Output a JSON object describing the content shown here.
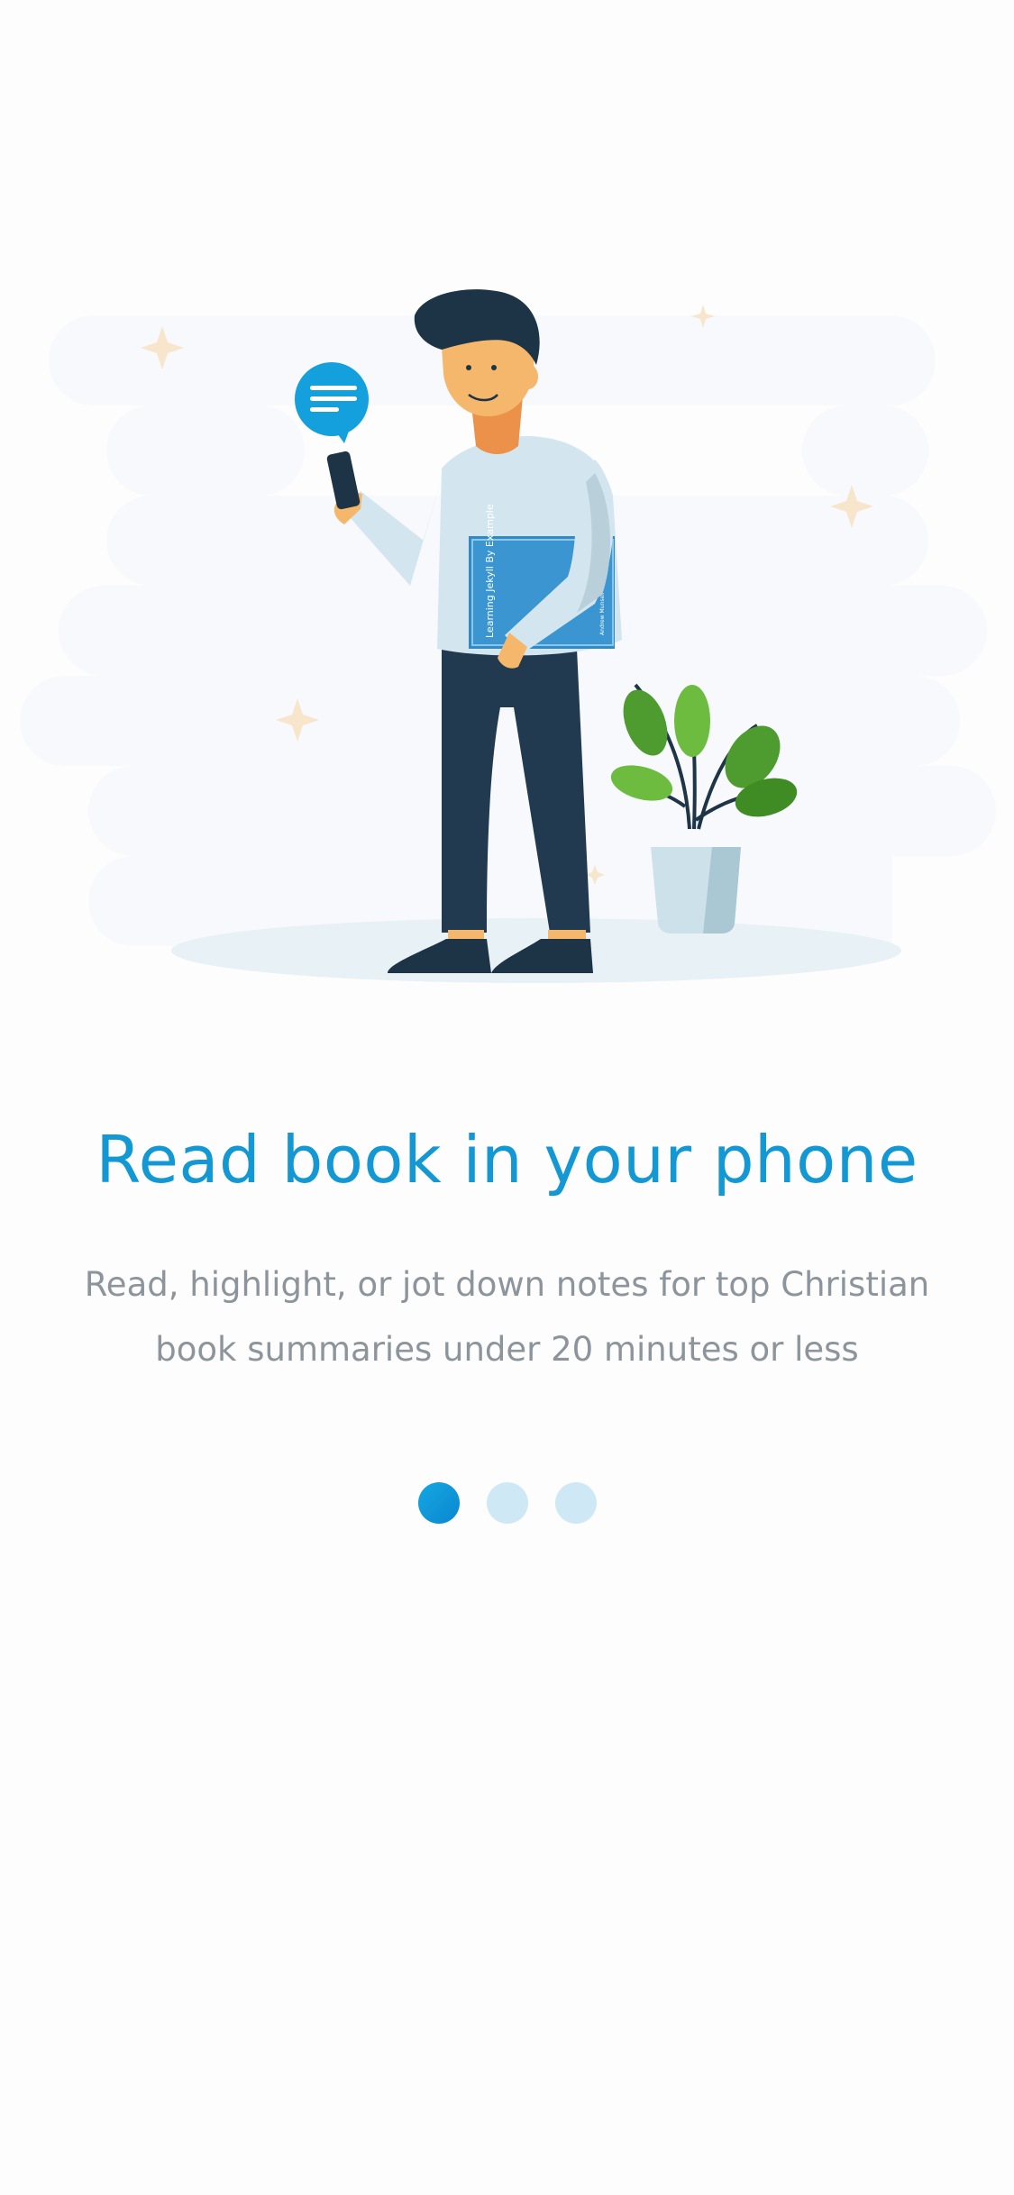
{
  "onboarding": {
    "title": "Read book in your phone",
    "subtitle_lines": [
      "Read, highlight, or jot down notes for top Christian",
      "book summaries under 20 minutes or less"
    ],
    "book_cover_title": "Learning Jekyll By Example",
    "book_cover_author": "Andrew Munsell",
    "page_indicator": {
      "total": 3,
      "active_index": 0
    }
  },
  "colors": {
    "accent": "#1398d4",
    "subtitle": "#8c949c",
    "dot_inactive": "#cfe8f5",
    "cloud": "#f7f9fc",
    "shirt": "#d3e6ef",
    "pants": "#213a4f",
    "book": "#2f8ac6",
    "leaf": "#5cab3a"
  }
}
